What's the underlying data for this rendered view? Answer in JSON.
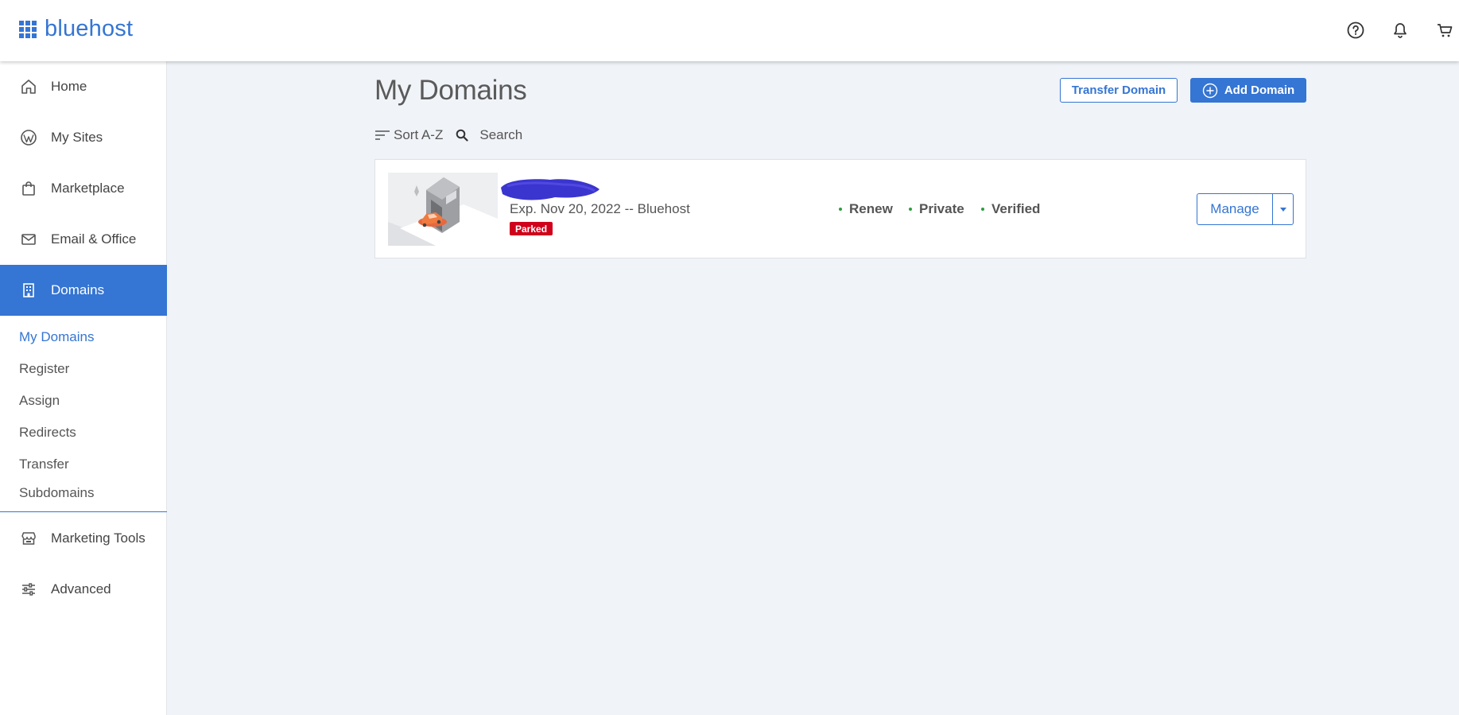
{
  "brand": {
    "name": "bluehost",
    "accent": "#3575d3"
  },
  "header": {
    "icons": [
      "help-icon",
      "bell-icon",
      "cart-icon"
    ]
  },
  "sidebar": {
    "items": [
      {
        "label": "Home",
        "icon": "home-icon"
      },
      {
        "label": "My Sites",
        "icon": "wordpress-icon"
      },
      {
        "label": "Marketplace",
        "icon": "shopping-bag-icon"
      },
      {
        "label": "Email & Office",
        "icon": "mail-icon"
      },
      {
        "label": "Domains",
        "icon": "building-icon",
        "active": true
      },
      {
        "label": "Marketing Tools",
        "icon": "storefront-icon"
      },
      {
        "label": "Advanced",
        "icon": "sliders-icon"
      }
    ],
    "subitems": [
      {
        "label": "My Domains",
        "current": true
      },
      {
        "label": "Register"
      },
      {
        "label": "Assign"
      },
      {
        "label": "Redirects"
      },
      {
        "label": "Transfer"
      },
      {
        "label": "Subdomains"
      }
    ]
  },
  "main": {
    "title": "My Domains",
    "transfer_label": "Transfer Domain",
    "add_label": "Add Domain",
    "sort_label": "Sort A-Z",
    "search_label": "Search"
  },
  "domains": [
    {
      "expiry": "Exp. Nov 20, 2022 -- Bluehost",
      "badge": "Parked",
      "statuses": [
        "Renew",
        "Private",
        "Verified"
      ],
      "manage_label": "Manage"
    }
  ],
  "colors": {
    "badge": "#d0021b",
    "status_dot": "#2e9e3f",
    "background": "#f0f3f7"
  }
}
